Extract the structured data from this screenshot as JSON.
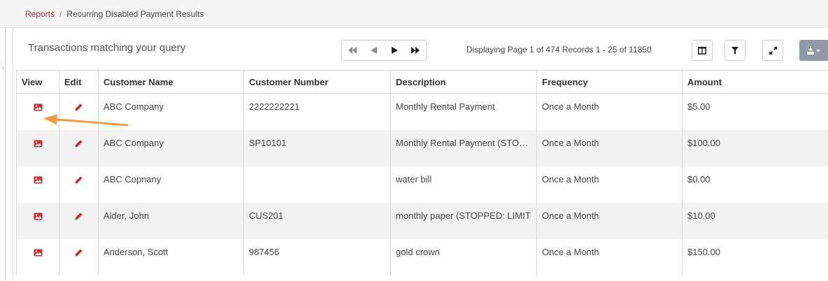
{
  "breadcrumb": {
    "parent": "Reports",
    "separator": "/",
    "current": "Recurring Disabled Payment Results"
  },
  "panel": {
    "title": "Transactions matching your query"
  },
  "pagination": {
    "status": "Displaying Page 1 of 474 Records 1 - 25 of 11850",
    "first_icon": "double-chevron-left-icon",
    "prev_icon": "chevron-left-icon",
    "next_icon": "chevron-right-icon",
    "last_icon": "double-chevron-right-icon"
  },
  "toolbar": {
    "columns_icon": "columns-icon",
    "filter_icon": "filter-icon",
    "expand_icon": "expand-icon",
    "export_icon": "download-icon"
  },
  "table": {
    "headers": [
      "View",
      "Edit",
      "Customer Name",
      "Customer Number",
      "Description",
      "Frequency",
      "Amount"
    ],
    "rows": [
      {
        "customer_name": "ABC Company",
        "customer_number": "2222222221",
        "description": "Monthly Rental Payment",
        "frequency": "Once a Month",
        "amount": "$5.00"
      },
      {
        "customer_name": "ABC Company",
        "customer_number": "SP10101",
        "description": "Monthly Rental Payment (STOPPED",
        "frequency": "Once a Month",
        "amount": "$100.00"
      },
      {
        "customer_name": "ABC Copnany",
        "customer_number": "",
        "description": "water bill",
        "frequency": "Once a Month",
        "amount": "$0.00"
      },
      {
        "customer_name": "Alder, John",
        "customer_number": "CUS201",
        "description": "monthly paper (STOPPED: LIMIT",
        "frequency": "Once a Month",
        "amount": "$10.00"
      },
      {
        "customer_name": "Anderson, Scott",
        "customer_number": "987456",
        "description": "gold crown",
        "frequency": "Once a Month",
        "amount": "$150.00"
      }
    ]
  },
  "colors": {
    "view_icon": "#d9262c",
    "edit_icon": "#c5282f",
    "annotation_arrow": "#f39a4a",
    "breadcrumb_link": "#b0293a",
    "export_button": "#8f9aa5"
  }
}
